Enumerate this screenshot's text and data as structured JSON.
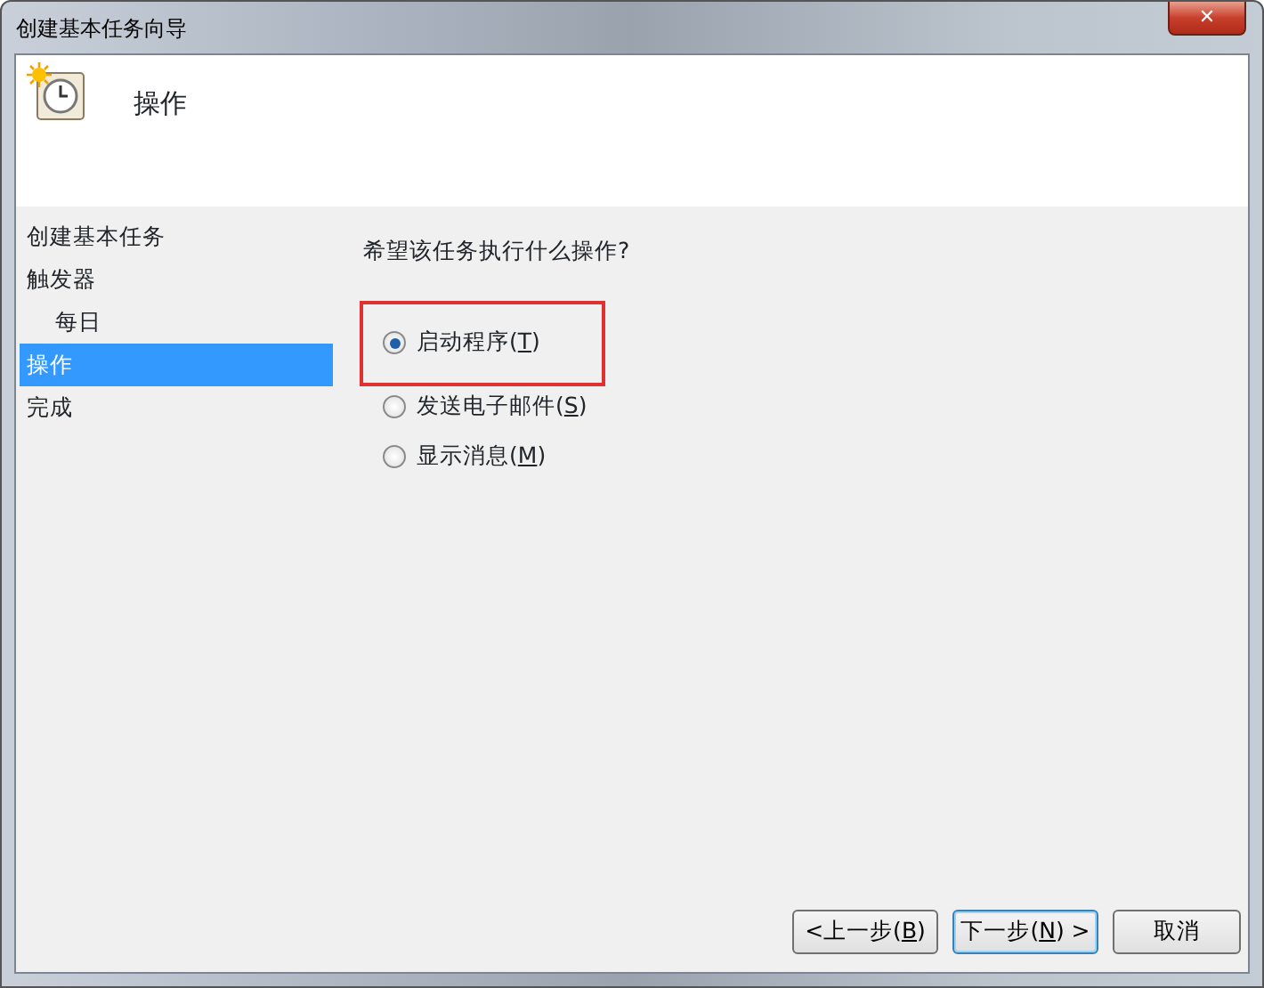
{
  "window": {
    "title": "创建基本任务向导",
    "close": "✕"
  },
  "header": {
    "title": "操作"
  },
  "steps": [
    {
      "label": "创建基本任务",
      "selected": false
    },
    {
      "label": "触发器",
      "selected": false,
      "children": [
        {
          "label": "每日",
          "selected": false
        }
      ]
    },
    {
      "label": "操作",
      "selected": true
    },
    {
      "label": "完成",
      "selected": false
    }
  ],
  "question": "希望该任务执行什么操作?",
  "options": [
    {
      "text": "启动程序(",
      "key": "T",
      "tail": ")",
      "selected": true,
      "highlighted": true
    },
    {
      "text": "发送电子邮件(",
      "key": "S",
      "tail": ")",
      "selected": false,
      "highlighted": false
    },
    {
      "text": "显示消息(",
      "key": "M",
      "tail": ")",
      "selected": false,
      "highlighted": false
    }
  ],
  "buttons": [
    {
      "text": "<上一步(",
      "key": "B",
      "tail": ")",
      "default": false
    },
    {
      "text": "下一步(",
      "key": "N",
      "tail": ") >",
      "default": true
    },
    {
      "text": "取消",
      "default": false
    }
  ]
}
